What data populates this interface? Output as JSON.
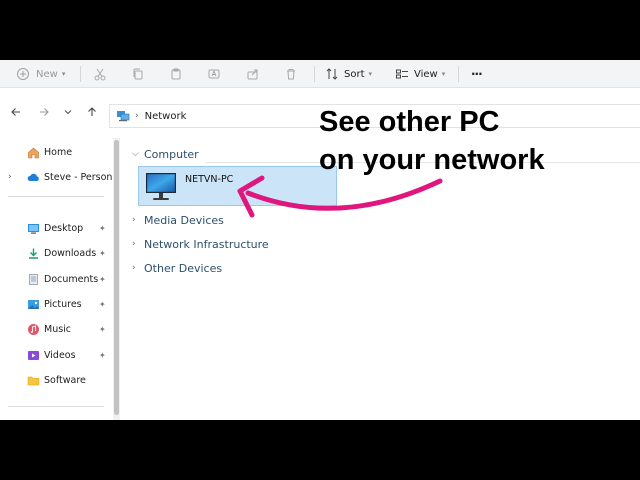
{
  "toolbar": {
    "new_label": "New",
    "sort_label": "Sort",
    "view_label": "View",
    "more_label": "···"
  },
  "address": {
    "location": "Network"
  },
  "sidebar": {
    "home": "Home",
    "onedrive": "Steve - Personal",
    "items": [
      {
        "label": "Desktop",
        "pinned": true
      },
      {
        "label": "Downloads",
        "pinned": true
      },
      {
        "label": "Documents",
        "pinned": true
      },
      {
        "label": "Pictures",
        "pinned": true
      },
      {
        "label": "Music",
        "pinned": true
      },
      {
        "label": "Videos",
        "pinned": true
      },
      {
        "label": "Software",
        "pinned": false
      }
    ],
    "pin_glyph": "📌"
  },
  "content": {
    "groups": [
      "Computer",
      "Media Devices",
      "Network Infrastructure",
      "Other Devices"
    ],
    "computer_item": "NETVN-PC"
  },
  "annotation": {
    "line1": "See other PC",
    "line2": "on your network",
    "arrow_color": "#e0167f"
  }
}
